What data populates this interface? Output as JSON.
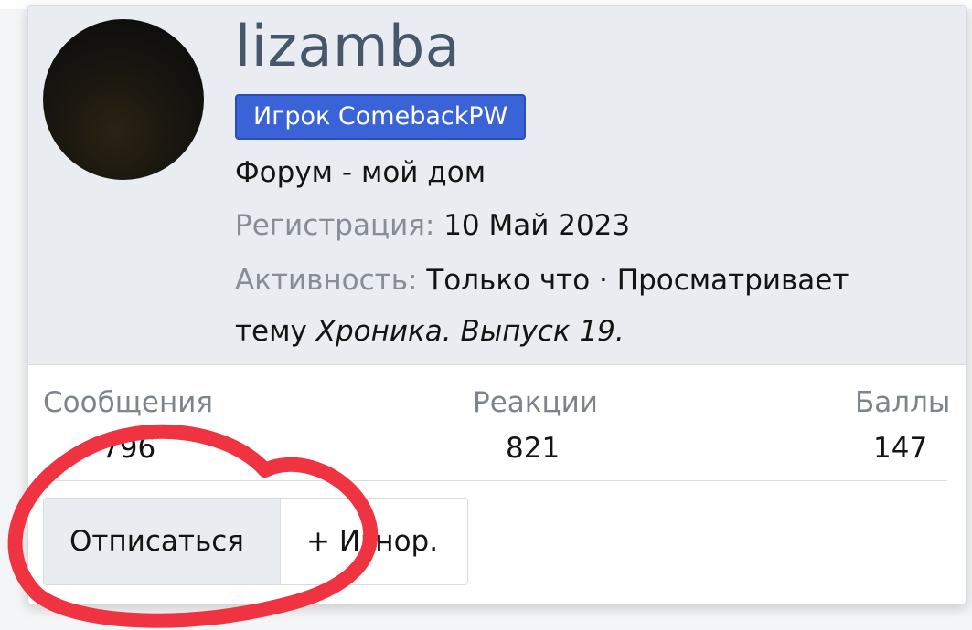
{
  "profile": {
    "username": "lizamba",
    "role_badge": "Игрок ComebackPW",
    "user_title": "Форум - мой дом",
    "registration": {
      "label": "Регистрация:",
      "value": "10 Май 2023"
    },
    "activity": {
      "label": "Активность:",
      "value": "Только что · Просматривает тему",
      "thread": "Хроника. Выпуск 19."
    }
  },
  "stats": [
    {
      "label": "Сообщения",
      "value": "796"
    },
    {
      "label": "Реакции",
      "value": "821"
    },
    {
      "label": "Баллы",
      "value": "147"
    }
  ],
  "actions": {
    "unfollow_label": "Отписаться",
    "ignore_label": "+ Игнор."
  },
  "colors": {
    "header_bg": "#e9ecf0",
    "username": "#47576b",
    "badge_bg": "#3b63d8",
    "annotation": "#ef3340"
  },
  "icons": {
    "avatar": "avatar-image"
  }
}
